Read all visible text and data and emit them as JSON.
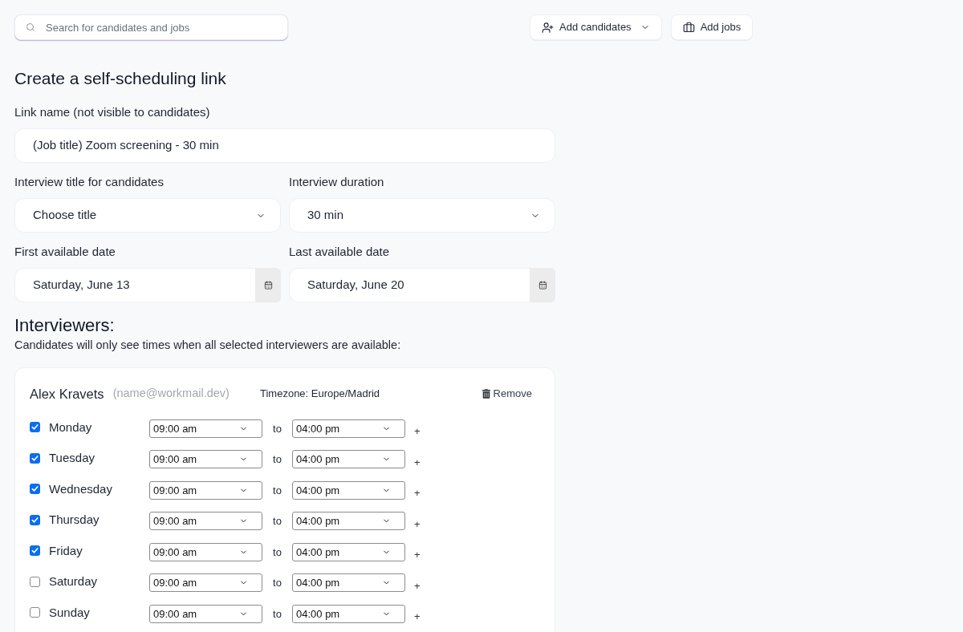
{
  "search": {
    "placeholder": "Search for candidates and jobs"
  },
  "toolbar_buttons": [
    {
      "kind": "add-person",
      "label": "Add candidates",
      "has_menu": true
    },
    {
      "kind": "briefcase",
      "label": "Add jobs",
      "has_menu": false
    }
  ],
  "page_title": "Create a self-scheduling link",
  "link_name": {
    "label": "Link name (not visible to candidates)",
    "value": "(Job title) Zoom screening - 30 min"
  },
  "field_rows": [
    [
      {
        "kind": "select",
        "label": "Interview title for candidates",
        "value": "Choose title"
      },
      {
        "kind": "select",
        "label": "Interview duration",
        "value": "30 min"
      }
    ],
    [
      {
        "kind": "date",
        "label": "First available date",
        "value": "Saturday, June 13"
      },
      {
        "kind": "date",
        "label": "Last available date",
        "value": "Saturday, June 20"
      }
    ]
  ],
  "interviewers": {
    "heading": "Interviewers:",
    "note": "Candidates will only see times when all selected interviewers are available:",
    "cards": [
      {
        "name": "Alex Kravets",
        "email": "(name@workmail.dev)",
        "timezone": "Timezone: Europe/Madrid",
        "remove_label": "Remove",
        "schedule": [
          {
            "day": "Monday",
            "checked": true,
            "start": "09:00 am",
            "separator": "to",
            "end": "04:00 pm",
            "add": "+"
          },
          {
            "day": "Tuesday",
            "checked": true,
            "start": "09:00 am",
            "separator": "to",
            "end": "04:00 pm",
            "add": "+"
          },
          {
            "day": "Wednesday",
            "checked": true,
            "start": "09:00 am",
            "separator": "to",
            "end": "04:00 pm",
            "add": "+"
          },
          {
            "day": "Thursday",
            "checked": true,
            "start": "09:00 am",
            "separator": "to",
            "end": "04:00 pm",
            "add": "+"
          },
          {
            "day": "Friday",
            "checked": true,
            "start": "09:00 am",
            "separator": "to",
            "end": "04:00 pm",
            "add": "+"
          },
          {
            "day": "Saturday",
            "checked": false,
            "start": "09:00 am",
            "separator": "to",
            "end": "04:00 pm",
            "add": "+"
          },
          {
            "day": "Sunday",
            "checked": false,
            "start": "09:00 am",
            "separator": "to",
            "end": "04:00 pm",
            "add": "+"
          }
        ]
      }
    ]
  }
}
